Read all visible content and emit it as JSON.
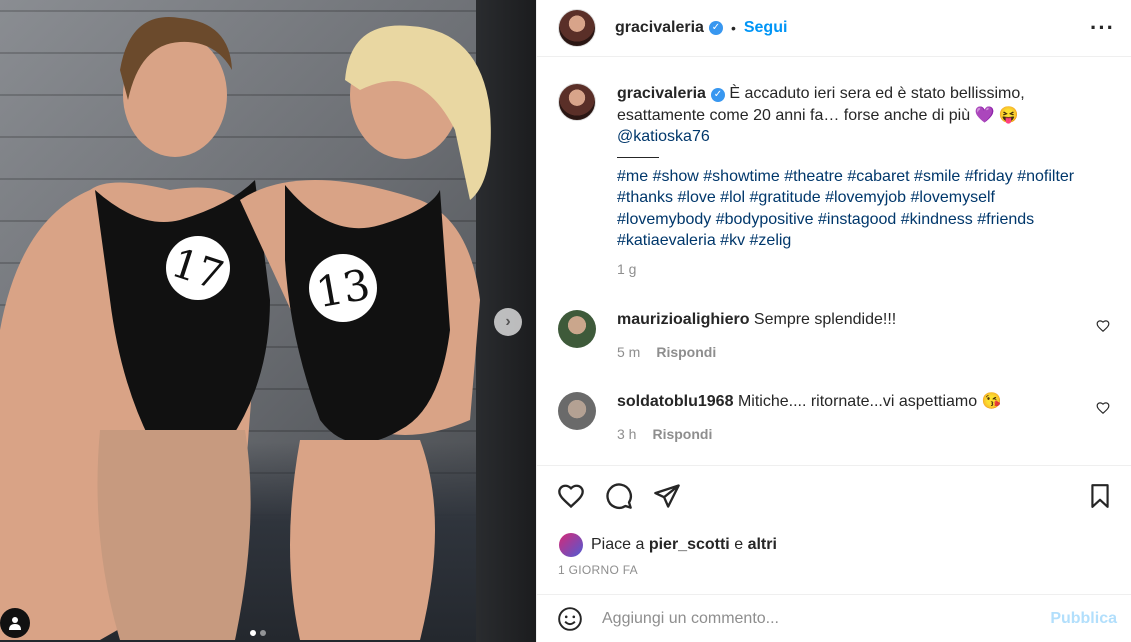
{
  "post": {
    "username": "gracivaleria",
    "follow_label": "Segui",
    "more_icon": "ellipsis-icon",
    "caption_text": "È accaduto ieri sera ed è stato bellissimo, esattamente come 20 anni fa… forse anche di più 💜 😝",
    "mention": "@katioska76",
    "hashtags": "#me #show #showtime #theatre #cabaret #smile #friday #nofilter #thanks #love #lol #gratitude #lovemyjob #lovemyself #lovemybody #bodypositive #instagood #kindness #friends #katiaevaleria #kv #zelig",
    "caption_time": "1 g"
  },
  "photo": {
    "number_left": "17",
    "number_right": "13"
  },
  "comments": [
    {
      "username": "maurizioalighiero",
      "text": "Sempre splendide!!!",
      "time": "5 m",
      "reply": "Rispondi"
    },
    {
      "username": "soldatoblu1968",
      "text": "Mitiche.... ritornate...vi aspettiamo 😘",
      "time": "3 h",
      "reply": "Rispondi"
    }
  ],
  "likes": {
    "prefix": "Piace a",
    "user": "pier_scotti",
    "joiner": "e",
    "others": "altri"
  },
  "date_label": "1 GIORNO FA",
  "add_comment": {
    "placeholder": "Aggiungi un commento...",
    "post_label": "Pubblica"
  },
  "colors": {
    "link_blue": "#0095f6",
    "tag_blue": "#00376b",
    "muted": "#8e8e8e"
  }
}
